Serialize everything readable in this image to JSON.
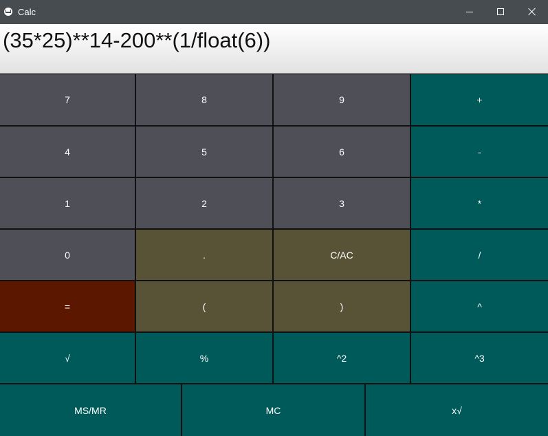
{
  "window": {
    "title": "Calc",
    "icon": "app-logo-icon",
    "controls": {
      "minimize_icon": "minimize-icon",
      "maximize_icon": "maximize-icon",
      "close_icon": "close-icon"
    }
  },
  "display": {
    "expression": "(35*25)**14-200**(1/float(6))"
  },
  "colors": {
    "titlebar": "#474c51",
    "number_key": "#4e4f57",
    "operator_key": "#005a5a",
    "control_key": "#585236",
    "equals_key": "#5c1700"
  },
  "keys": {
    "seven": "7",
    "eight": "8",
    "nine": "9",
    "plus": "+",
    "four": "4",
    "five": "5",
    "six": "6",
    "minus": "-",
    "one": "1",
    "two": "2",
    "three": "3",
    "multiply": "*",
    "zero": "0",
    "dot": ".",
    "clear": "C/AC",
    "divide": "/",
    "equals": "=",
    "open_paren": "(",
    "close_paren": ")",
    "caret": "^",
    "sqrt": "√",
    "percent": "%",
    "square": "^2",
    "cube": "^3",
    "memory_store_recall": "MS/MR",
    "memory_clear": "MC",
    "nth_root": "x√"
  }
}
